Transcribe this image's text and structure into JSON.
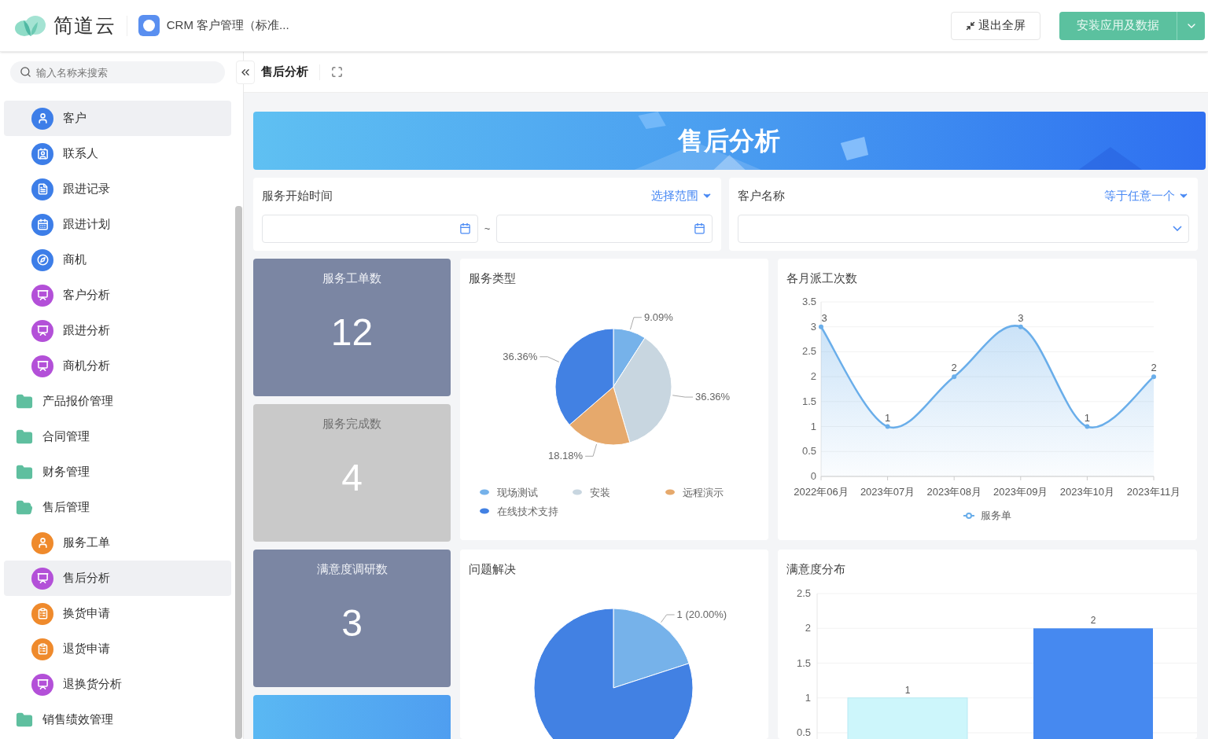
{
  "header": {
    "brand": "简道云",
    "app_title": "CRM 客户管理（标准...",
    "exit_button": "退出全屏",
    "install_button": "安装应用及数据"
  },
  "sidebar": {
    "search": {
      "placeholder": "输入名称来搜索"
    },
    "items": [
      {
        "label": "客户",
        "kind": "form",
        "color": "#3d7ee8",
        "selected": true
      },
      {
        "label": "联系人",
        "kind": "form",
        "color": "#3d7ee8",
        "selected": false
      },
      {
        "label": "跟进记录",
        "kind": "form",
        "color": "#3d7ee8",
        "selected": false
      },
      {
        "label": "跟进计划",
        "kind": "form",
        "color": "#3d7ee8",
        "selected": false
      },
      {
        "label": "商机",
        "kind": "form",
        "color": "#3d7ee8",
        "selected": false
      },
      {
        "label": "客户分析",
        "kind": "report",
        "color": "#b350d8",
        "selected": false
      },
      {
        "label": "跟进分析",
        "kind": "report",
        "color": "#b350d8",
        "selected": false
      },
      {
        "label": "商机分析",
        "kind": "report",
        "color": "#b350d8",
        "selected": false
      },
      {
        "label": "产品报价管理",
        "kind": "folder",
        "expanded": false,
        "selected": false
      },
      {
        "label": "合同管理",
        "kind": "folder",
        "expanded": false,
        "selected": false
      },
      {
        "label": "财务管理",
        "kind": "folder",
        "expanded": false,
        "selected": false
      },
      {
        "label": "售后管理",
        "kind": "folder",
        "expanded": true,
        "selected": false,
        "children": [
          {
            "label": "服务工单",
            "kind": "form",
            "color": "#ef8a2c",
            "selected": false
          },
          {
            "label": "售后分析",
            "kind": "report",
            "color": "#b350d8",
            "selected": true
          },
          {
            "label": "换货申请",
            "kind": "flow",
            "color": "#ef8a2c",
            "selected": false
          },
          {
            "label": "退货申请",
            "kind": "flow",
            "color": "#ef8a2c",
            "selected": false
          },
          {
            "label": "退换货分析",
            "kind": "report",
            "color": "#b350d8",
            "selected": false
          }
        ]
      },
      {
        "label": "销售绩效管理",
        "kind": "folder",
        "expanded": false,
        "selected": false
      }
    ]
  },
  "page": {
    "title": "售后分析",
    "banner_title": "售后分析"
  },
  "filters": [
    {
      "kind": "date_range",
      "label": "服务开始时间",
      "mode": "选择范围",
      "separator": "~"
    },
    {
      "kind": "select",
      "label": "客户名称",
      "mode": "等于任意一个"
    }
  ],
  "stats": [
    {
      "label": "服务工单数",
      "value": "12",
      "color": "#7b86a3"
    },
    {
      "label": "服务完成数",
      "value": "4",
      "color": "#c9c9c9"
    },
    {
      "label": "满意度调研数",
      "value": "3",
      "color": "#7b86a3"
    }
  ],
  "charts": [
    {
      "title": "服务类型",
      "chart_data": {
        "type": "pie",
        "categories": [
          "现场测试",
          "安装",
          "远程演示",
          "在线技术支持"
        ],
        "values": [
          9.09,
          36.36,
          18.18,
          36.36
        ],
        "legend": "bottom",
        "colors": [
          "#76b2ea",
          "#c8d6e0",
          "#e6a96c",
          "#4281e3"
        ],
        "value_labels": [
          "9.09%",
          "36.36%",
          "18.18%",
          "36.36%"
        ]
      }
    },
    {
      "title": "各月派工次数",
      "chart_data": {
        "type": "area",
        "categories": [
          "2022年06月",
          "2023年07月",
          "2023年08月",
          "2023年09月",
          "2023年10月",
          "2023年11月"
        ],
        "series": [
          {
            "name": "服务单",
            "color": "#6aaeea",
            "values": [
              3,
              1,
              2,
              3,
              1,
              2
            ]
          }
        ],
        "ylim": [
          0,
          3.5
        ],
        "yticks": [
          0,
          0.5,
          1,
          1.5,
          2,
          2.5,
          3,
          3.5
        ],
        "grid": true,
        "legend": "bottom",
        "data_labels": true
      }
    },
    {
      "title": "问题解决",
      "chart_data": {
        "type": "pie",
        "values": [
          20,
          80
        ],
        "colors": [
          "#76b2ea",
          "#4281e3"
        ],
        "value_labels": [
          "1 (20.00%)",
          null
        ]
      }
    },
    {
      "title": "满意度分布",
      "chart_data": {
        "type": "bar",
        "values": [
          1,
          2
        ],
        "colors": [
          "#cdf6fb",
          "#4689f0"
        ],
        "ylim": [
          0,
          2.5
        ],
        "yticks": [
          0.5,
          1,
          1.5,
          2,
          2.5
        ],
        "grid": true,
        "data_labels": true
      }
    }
  ]
}
